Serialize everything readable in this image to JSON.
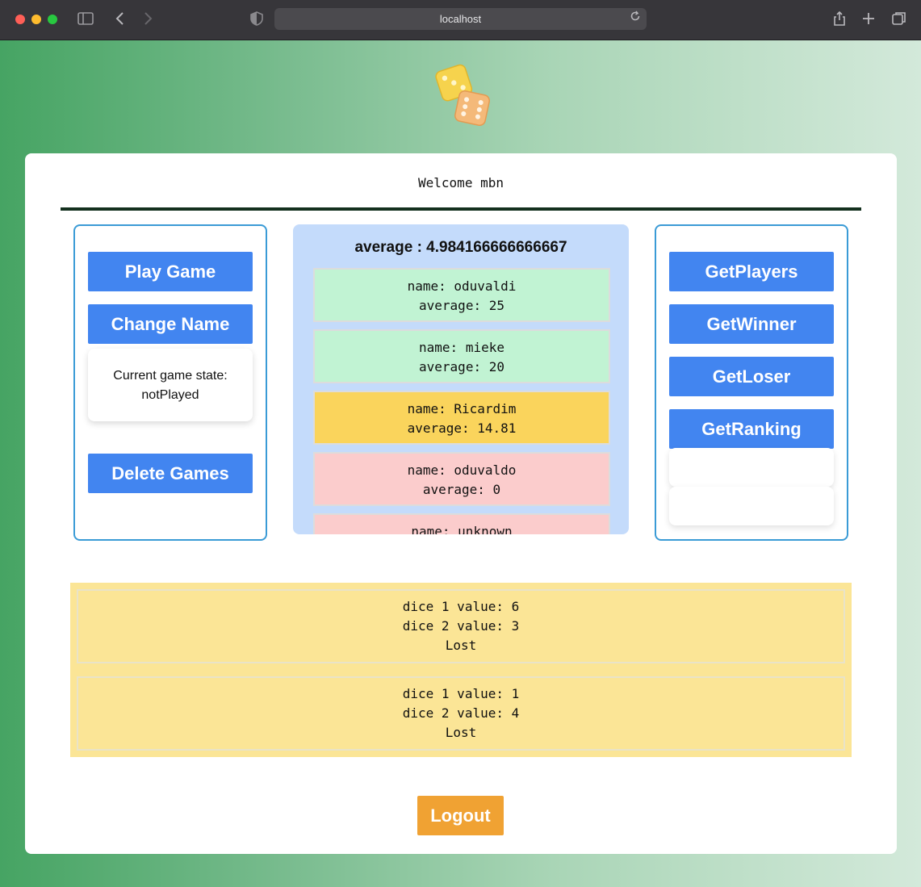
{
  "browser": {
    "url": "localhost",
    "sidebar_icon": "sidebar-icon",
    "back_icon": "chevron-left-icon",
    "forward_icon": "chevron-right-icon",
    "shield_icon": "shield-icon",
    "reload_icon": "reload-icon",
    "share_icon": "share-icon",
    "new_tab_icon": "plus-icon",
    "tabs_icon": "tabs-icon"
  },
  "header": {
    "welcome": "Welcome mbn"
  },
  "left_panel": {
    "play_label": "Play Game",
    "change_name_label": "Change Name",
    "state_line1": "Current game state:",
    "state_line2": "notPlayed",
    "delete_label": "Delete Games"
  },
  "ranking": {
    "title": "average : 4.984166666666667",
    "players": [
      {
        "name": "name: oduvaldi",
        "average": "average: 25",
        "color": "#c1f3d3"
      },
      {
        "name": "name: mieke",
        "average": "average: 20",
        "color": "#c1f3d3"
      },
      {
        "name": "name: Ricardim",
        "average": "average: 14.81",
        "color": "#fad45c"
      },
      {
        "name": "name: oduvaldo",
        "average": "average: 0",
        "color": "#fbcccc"
      },
      {
        "name": "name: unknown",
        "average": "",
        "color": "#fbcccc"
      }
    ]
  },
  "right_panel": {
    "get_players": "GetPlayers",
    "get_winner": "GetWinner",
    "get_loser": "GetLoser",
    "get_ranking": "GetRanking"
  },
  "games": [
    {
      "dice1": "dice 1 value: 6",
      "dice2": "dice 2 value: 3",
      "result": "Lost"
    },
    {
      "dice1": "dice 1 value: 1",
      "dice2": "dice 2 value: 4",
      "result": "Lost"
    }
  ],
  "logout_label": "Logout",
  "colors": {
    "primary_button": "#4285f0",
    "logout_button": "#f0a233",
    "panel_border": "#3a9bd6",
    "ranking_bg": "#c4dbfb",
    "results_bg": "#fbe596"
  }
}
